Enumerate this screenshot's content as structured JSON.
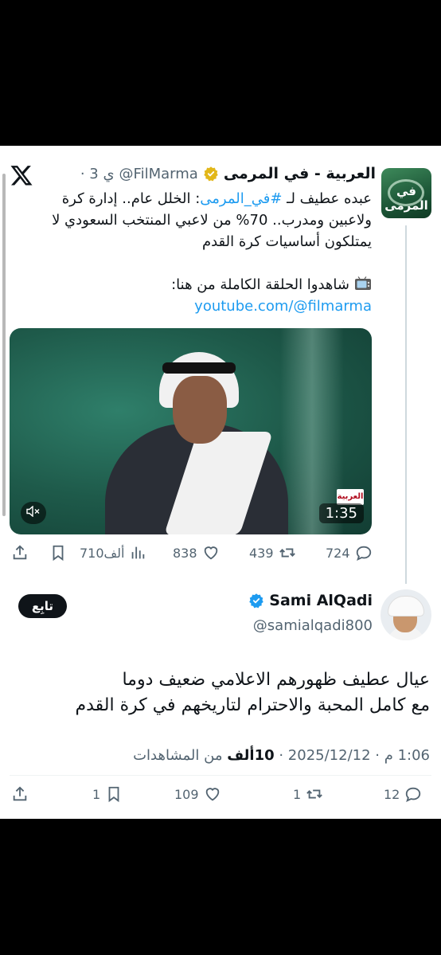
{
  "quoted_tweet": {
    "account_name": "العربية - في المرمى",
    "handle": "@FilMarma",
    "time": "· 3 ي",
    "avatar_text": "في المرمى",
    "text_before_hashtag": "عبده عطيف لـ ",
    "hashtag": "#في_المرمى",
    "text_after_hashtag": ": الخلل عام.. إدارة كرة ولاعبين ومدرب.. 70% من لاعبي المنتخب السعودي لا يمتلكون أساسيات كرة القدم",
    "watch_text": "شاهدوا الحلقة الكاملة من هنا:",
    "link": "youtube.com/@filmarma",
    "video": {
      "duration": "1:35",
      "channel_logo": "العربية",
      "mute_icon": "speaker-muted-icon"
    },
    "stats": {
      "replies": "724",
      "retweets": "439",
      "likes": "838",
      "views": "710ألف"
    }
  },
  "main_tweet": {
    "author_name": "Sami AlQadi",
    "handle": "@samialqadi800",
    "follow_label": "تابِع",
    "body_line1": "عيال عطيف ظهورهم الاعلامي ضعيف دوما",
    "body_line2": "مع كامل المحبة والاحترام لتاريخهم في كرة القدم",
    "meta_time": "1:06 م · 2025/12/12 · ",
    "meta_views": "10ألف",
    "meta_views_suffix": " من المشاهدات",
    "stats": {
      "replies": "12",
      "retweets": "1",
      "likes": "109",
      "bookmarks": "1"
    }
  },
  "colors": {
    "accent": "#1d9bf0",
    "text": "#0f1419",
    "secondary": "#536471",
    "verified_gold": "#e2b719"
  }
}
